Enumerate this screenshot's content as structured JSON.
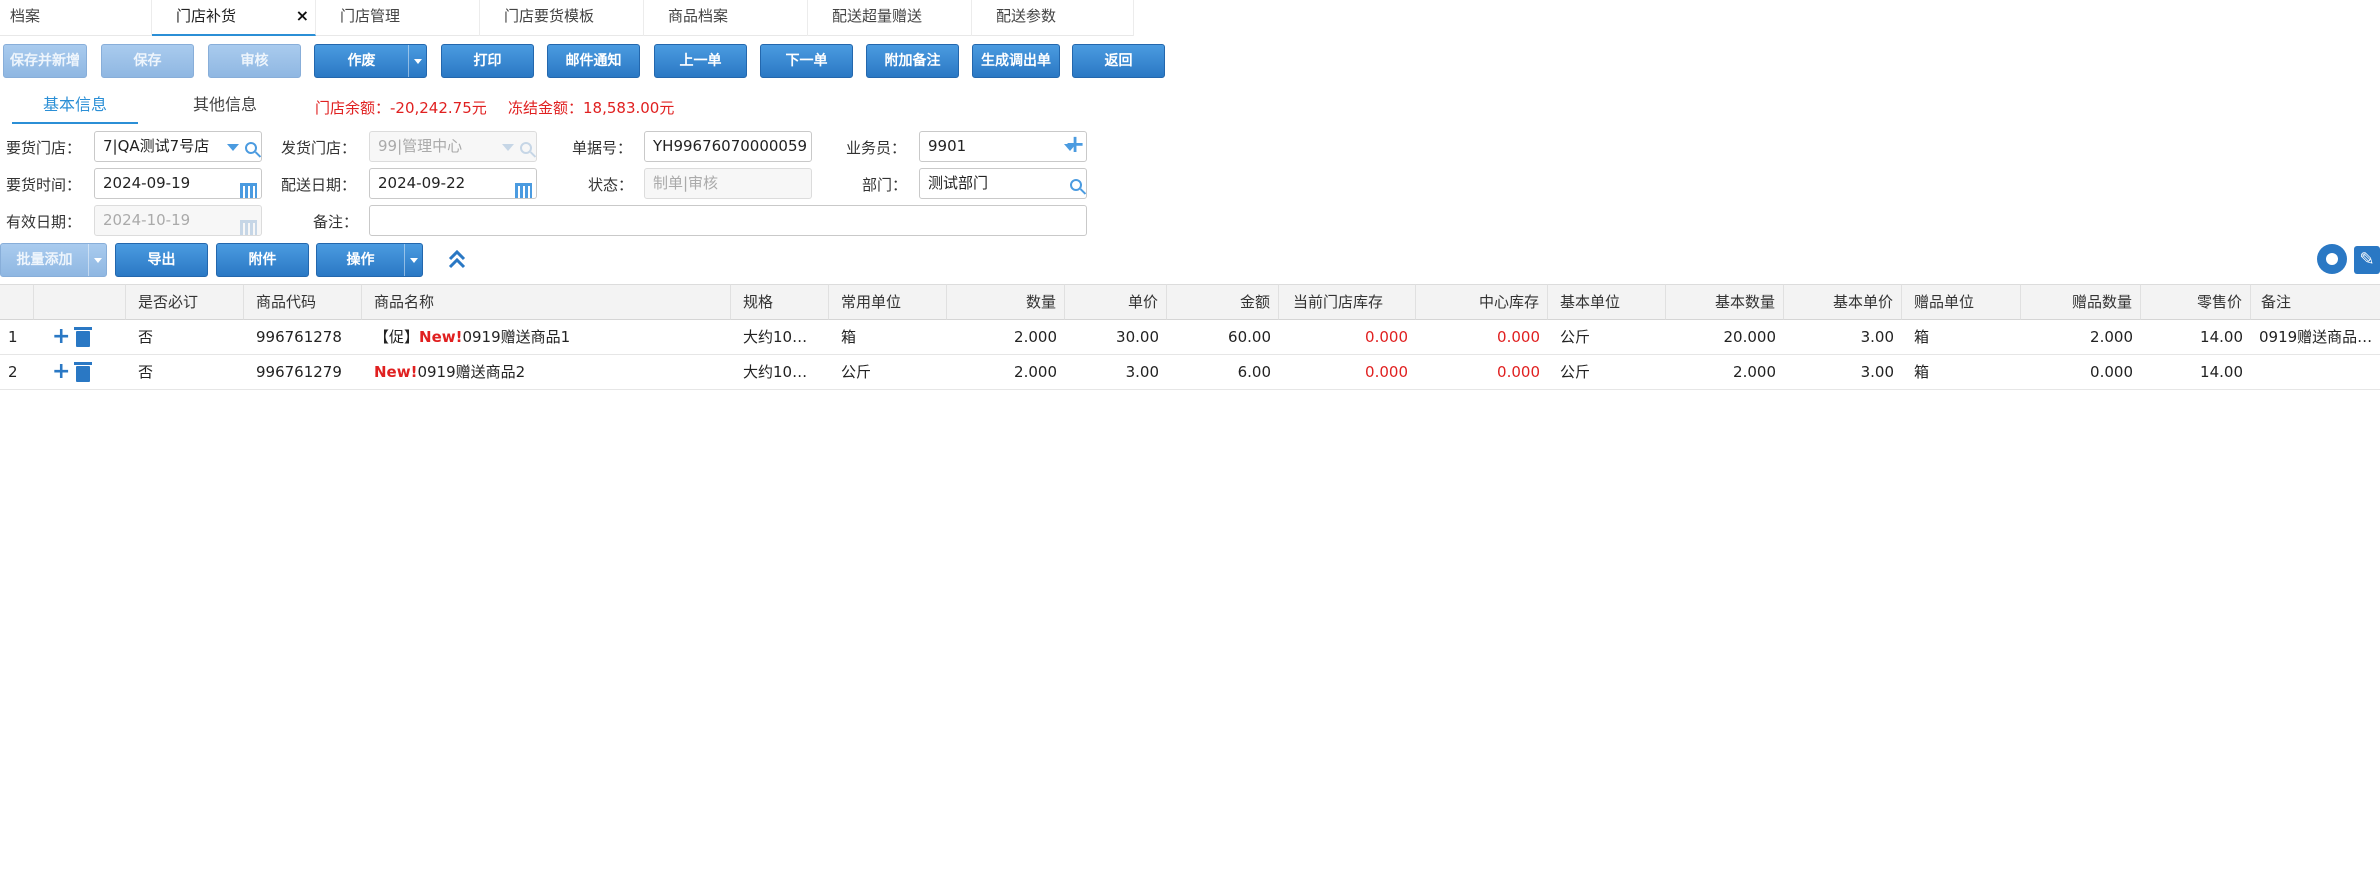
{
  "tabs": [
    {
      "label": "档案"
    },
    {
      "label": "门店补货",
      "close": "×"
    },
    {
      "label": "门店管理"
    },
    {
      "label": "门店要货模板"
    },
    {
      "label": "商品档案"
    },
    {
      "label": "配送超量赠送"
    },
    {
      "label": "配送参数"
    }
  ],
  "toolbar": {
    "save_new": "保存并新增",
    "save": "保存",
    "audit": "审核",
    "void": "作废",
    "print": "打印",
    "mail": "邮件通知",
    "prev": "上一单",
    "next": "下一单",
    "remark": "附加备注",
    "transfer": "生成调出单",
    "back": "返回"
  },
  "subtabs": {
    "basic": "基本信息",
    "other": "其他信息"
  },
  "balance": {
    "store": "门店余额：-20,242.75元",
    "frozen": "冻结金额：18,583.00元"
  },
  "form": {
    "req_store_label": "要货门店：",
    "req_store": "7|QA测试7号店",
    "ship_store_label": "发货门店：",
    "ship_store": "99|管理中心",
    "doc_no_label": "单据号：",
    "doc_no": "YH99676070000059",
    "staff_label": "业务员：",
    "staff": "9901",
    "req_time_label": "要货时间：",
    "req_time": "2024-09-19",
    "ship_date_label": "配送日期：",
    "ship_date": "2024-09-22",
    "status_label": "状态：",
    "status_placeholder": "制单|审核",
    "dept_label": "部门：",
    "dept": "测试部门",
    "valid_label": "有效日期：",
    "valid": "2024-10-19",
    "note_label": "备注：",
    "note": ""
  },
  "grid_toolbar": {
    "batch_add": "批量添加",
    "export": "导出",
    "attach": "附件",
    "operate": "操作"
  },
  "columns": [
    "是否必订",
    "商品代码",
    "商品名称",
    "规格",
    "常用单位",
    "数量",
    "单价",
    "金额",
    "当前门店库存",
    "中心库存",
    "基本单位",
    "基本数量",
    "基本单价",
    "赠品单位",
    "赠品数量",
    "零售价",
    "备注"
  ],
  "rows": [
    {
      "idx": "1",
      "must": "否",
      "code": "996761278",
      "name_prefix": "【促】",
      "new": "New!",
      "name": "0919赠送商品1",
      "spec": "大约10…",
      "unit": "箱",
      "qty": "2.000",
      "price": "30.00",
      "amount": "60.00",
      "store_stock": "0.000",
      "center_stock": "0.000",
      "base_unit": "公斤",
      "base_qty": "20.000",
      "base_price": "3.00",
      "gift_unit": "箱",
      "gift_qty": "2.000",
      "retail": "14.00",
      "remark": "0919赠送商品…"
    },
    {
      "idx": "2",
      "must": "否",
      "code": "996761279",
      "name_prefix": "",
      "new": "New!",
      "name": "0919赠送商品2",
      "spec": "大约10…",
      "unit": "公斤",
      "qty": "2.000",
      "price": "3.00",
      "amount": "6.00",
      "store_stock": "0.000",
      "center_stock": "0.000",
      "base_unit": "公斤",
      "base_qty": "2.000",
      "base_price": "3.00",
      "gift_unit": "箱",
      "gift_qty": "0.000",
      "retail": "14.00",
      "remark": ""
    }
  ]
}
